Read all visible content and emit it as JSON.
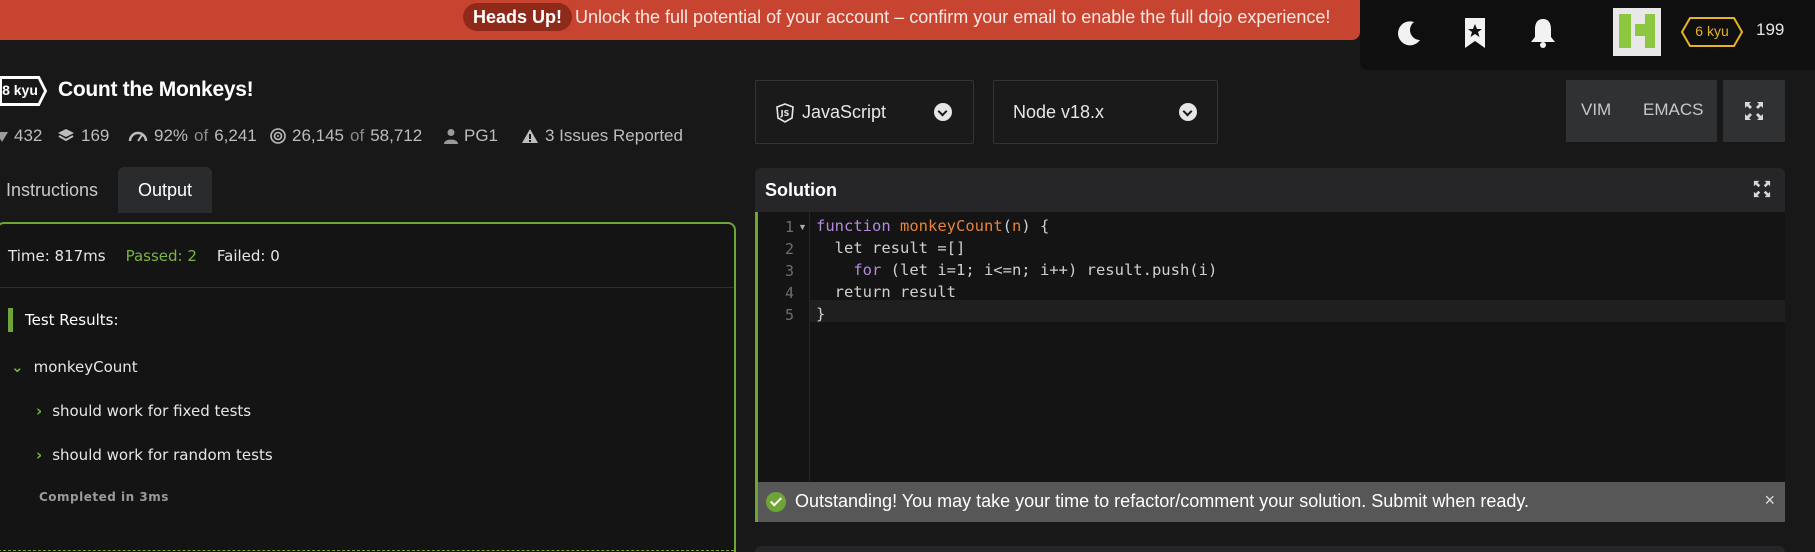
{
  "banner": {
    "badge": "Heads Up!",
    "text": "Unlock the full potential of your account – confirm your email to enable the full dojo experience!"
  },
  "user": {
    "rank": "6 kyu",
    "honor": "199"
  },
  "kata": {
    "rank": "8 kyu",
    "title": "Count the Monkeys!",
    "stats": {
      "stars": "432",
      "collections": "169",
      "satisfaction_pct": "92%",
      "of_word": "of",
      "satisfaction_votes": "6,241",
      "completed": "26,145",
      "attempted": "58,712",
      "author": "PG1",
      "issues": "3 Issues Reported"
    }
  },
  "tabs": [
    "Instructions",
    "Output"
  ],
  "output": {
    "time": "Time: 817ms",
    "passed": "Passed: 2",
    "failed": "Failed: 0",
    "results_header": "Test Results:",
    "suite": "monkeyCount",
    "tests": [
      "should work for fixed tests",
      "should work for random tests"
    ],
    "completed": "Completed in 3ms"
  },
  "editor": {
    "language": "JavaScript",
    "version": "Node v18.x",
    "modes": [
      "VIM",
      "EMACS"
    ],
    "title": "Solution",
    "line_numbers": [
      "1",
      "2",
      "3",
      "4",
      "5"
    ],
    "code": {
      "l1_kw": "function",
      "l1_fn": "monkeyCount",
      "l1_param": "n",
      "l1_rest": ") {",
      "l2": "  let result =[]",
      "l3_kw": "    for",
      "l3_rest": " (let i=1; i<=n; i++) result.push(i)",
      "l4": "  return result",
      "l5": "}"
    },
    "success_message": "Outstanding! You may take your time to refactor/comment your solution. Submit when ready.",
    "close_glyph": "×"
  },
  "colors": {
    "banner": "#c74430",
    "accent_green": "#6ea536",
    "kyu6": "#e6b422",
    "background": "#181818"
  }
}
